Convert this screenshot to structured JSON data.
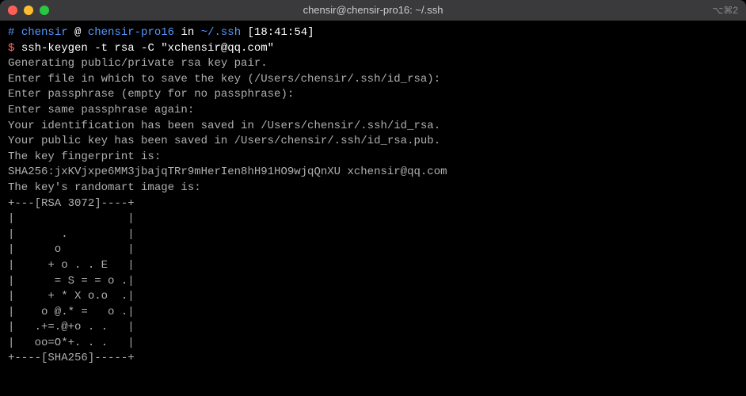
{
  "titlebar": {
    "title": "chensir@chensir-pro16: ~/.ssh",
    "right": "⌥⌘2"
  },
  "prompt": {
    "hash": "#",
    "user": "chensir",
    "at": "@",
    "host": "chensir-pro16",
    "in": "in",
    "path": "~/.ssh",
    "time": "[18:41:54]"
  },
  "command": {
    "dollar": "$",
    "cmd": "ssh-keygen -t rsa -C \"xchensir@qq.com\""
  },
  "output": {
    "l1": "Generating public/private rsa key pair.",
    "l2": "Enter file in which to save the key (/Users/chensir/.ssh/id_rsa):",
    "l3": "Enter passphrase (empty for no passphrase):",
    "l4": "Enter same passphrase again:",
    "l5": "Your identification has been saved in /Users/chensir/.ssh/id_rsa.",
    "l6": "Your public key has been saved in /Users/chensir/.ssh/id_rsa.pub.",
    "l7": "The key fingerprint is:",
    "l8": "SHA256:jxKVjxpe6MM3jbajqTRr9mHerIen8hH91HO9wjqQnXU xchensir@qq.com",
    "l9": "The key's randomart image is:",
    "r01": "+---[RSA 3072]----+",
    "r02": "|                 |",
    "r03": "|       .         |",
    "r04": "|      o          |",
    "r05": "|     + o . . E   |",
    "r06": "|      = S = = o .|",
    "r07": "|     + * X o.o  .|",
    "r08": "|    o @.* =   o .|",
    "r09": "|   .+=.@+o . .   |",
    "r10": "|   oo=O*+. . .   |",
    "r11": "+----[SHA256]-----+"
  }
}
